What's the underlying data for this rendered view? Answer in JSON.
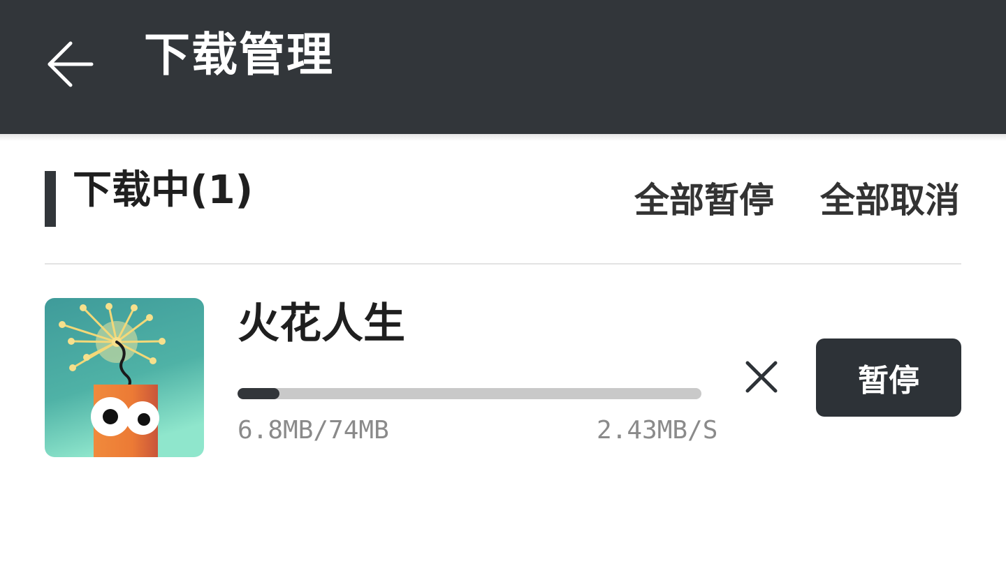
{
  "header": {
    "title": "下载管理",
    "back_icon": "arrow-left-icon",
    "background": "#32363a"
  },
  "section": {
    "title": "下载中(1)",
    "pause_all_label": "全部暂停",
    "cancel_all_label": "全部取消"
  },
  "downloads": [
    {
      "name": "火花人生",
      "icon": "firecracker-app-icon",
      "progress": 0.09,
      "size": "6.8MB/74MB",
      "speed": "2.43MB/S",
      "cancel_icon": "close-icon",
      "pause_label": "暂停"
    }
  ],
  "colors": {
    "accent": "#32363a",
    "track": "#c9c9c9",
    "secondary_text": "#8a8a8a"
  }
}
